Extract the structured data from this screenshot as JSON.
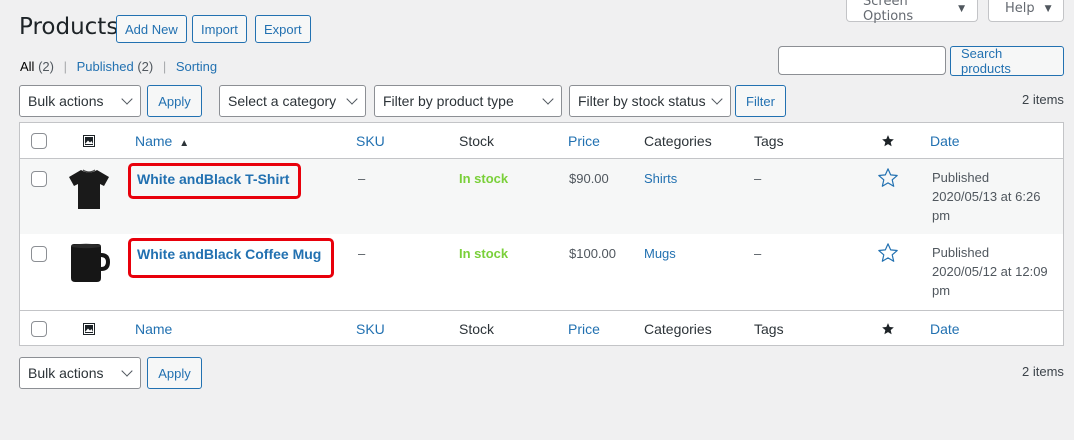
{
  "header": {
    "title": "Products",
    "add_new": "Add New",
    "import": "Import",
    "export": "Export",
    "screen_options": "Screen Options",
    "help": "Help"
  },
  "views": {
    "all": "All",
    "all_count": "(2)",
    "published": "Published",
    "published_count": "(2)",
    "sorting": "Sorting",
    "separator": "|"
  },
  "search": {
    "button": "Search products",
    "value": ""
  },
  "filters": {
    "bulk_actions": "Bulk actions",
    "apply": "Apply",
    "category": "Select a category",
    "product_type": "Filter by product type",
    "stock_status": "Filter by stock status",
    "filter_button": "Filter",
    "items_count": "2 items"
  },
  "columns": {
    "name": "Name",
    "sort_indicator": "▲",
    "sku": "SKU",
    "stock": "Stock",
    "price": "Price",
    "categories": "Categories",
    "tags": "Tags",
    "featured_icon": "star-filled-icon",
    "image_icon": "image-icon",
    "date": "Date"
  },
  "products": [
    {
      "name": "White andBlack T-Shirt",
      "sku": "–",
      "stock": "In stock",
      "price": "$90.00",
      "category": "Shirts",
      "tags": "–",
      "featured_icon": "star-outline-icon",
      "date_status": "Published",
      "date_line1": "2020/05/13 at 6:26",
      "date_line2": "pm",
      "thumbnail": "black-tshirt"
    },
    {
      "name": "White andBlack Coffee Mug",
      "sku": "–",
      "stock": "In stock",
      "price": "$100.00",
      "category": "Mugs",
      "tags": "–",
      "featured_icon": "star-outline-icon",
      "date_status": "Published",
      "date_line1": "2020/05/12 at 12:09",
      "date_line2": "pm",
      "thumbnail": "black-mug"
    }
  ],
  "colors": {
    "link": "#2271b1",
    "in_stock": "#7ad03a",
    "highlight": "#e8000b",
    "background": "#f0f0f1"
  }
}
